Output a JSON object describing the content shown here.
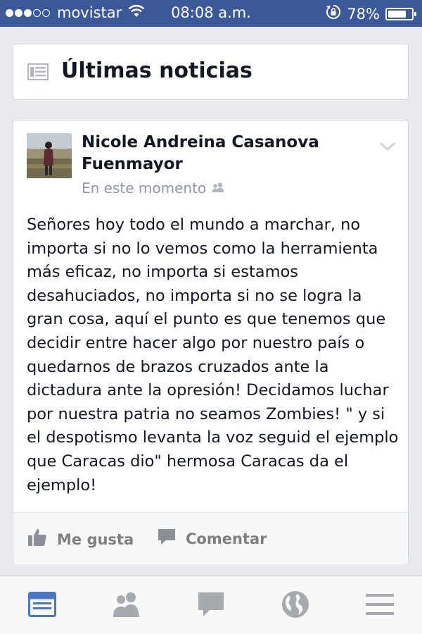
{
  "status_bar": {
    "carrier": "movistar",
    "time": "08:08 a.m.",
    "battery": "78%",
    "battery_level": 0.78,
    "signal_bars_filled": 3,
    "signal_bars_total": 5
  },
  "feed_header": {
    "title": "Últimas noticias",
    "icon": "news-feed-icon"
  },
  "post": {
    "author": "Nicole Andreina Casanova Fuenmayor",
    "timestamp": "En este momento",
    "audience_icon": "friends-icon",
    "body": "Señores hoy todo el mundo a marchar, no importa si no lo vemos como la herramienta más eficaz, no importa si estamos desahuciados, no importa si no se logra la gran cosa, aquí el punto es que tenemos que decidir entre hacer algo por nuestro país o quedarnos de brazos cruzados ante la dictadura ante la opresión! Decidamos luchar por nuestra patria no seamos Zombies! \" y si el despotismo levanta la voz seguid el ejemplo que Caracas dio\" hermosa Caracas da el ejemplo!",
    "actions": {
      "like": "Me gusta",
      "comment": "Comentar"
    }
  },
  "tab_bar": {
    "tabs": [
      "news-feed-tab-icon",
      "friend-requests-icon",
      "messages-icon",
      "notifications-globe-icon",
      "more-menu-icon"
    ],
    "active": 0
  },
  "colors": {
    "brand": "#3b5998",
    "background": "#e9eaed",
    "text": "#141823",
    "muted": "#9197a3",
    "tab_active": "#4a76c5",
    "tab_inactive": "#a6a9ae"
  }
}
